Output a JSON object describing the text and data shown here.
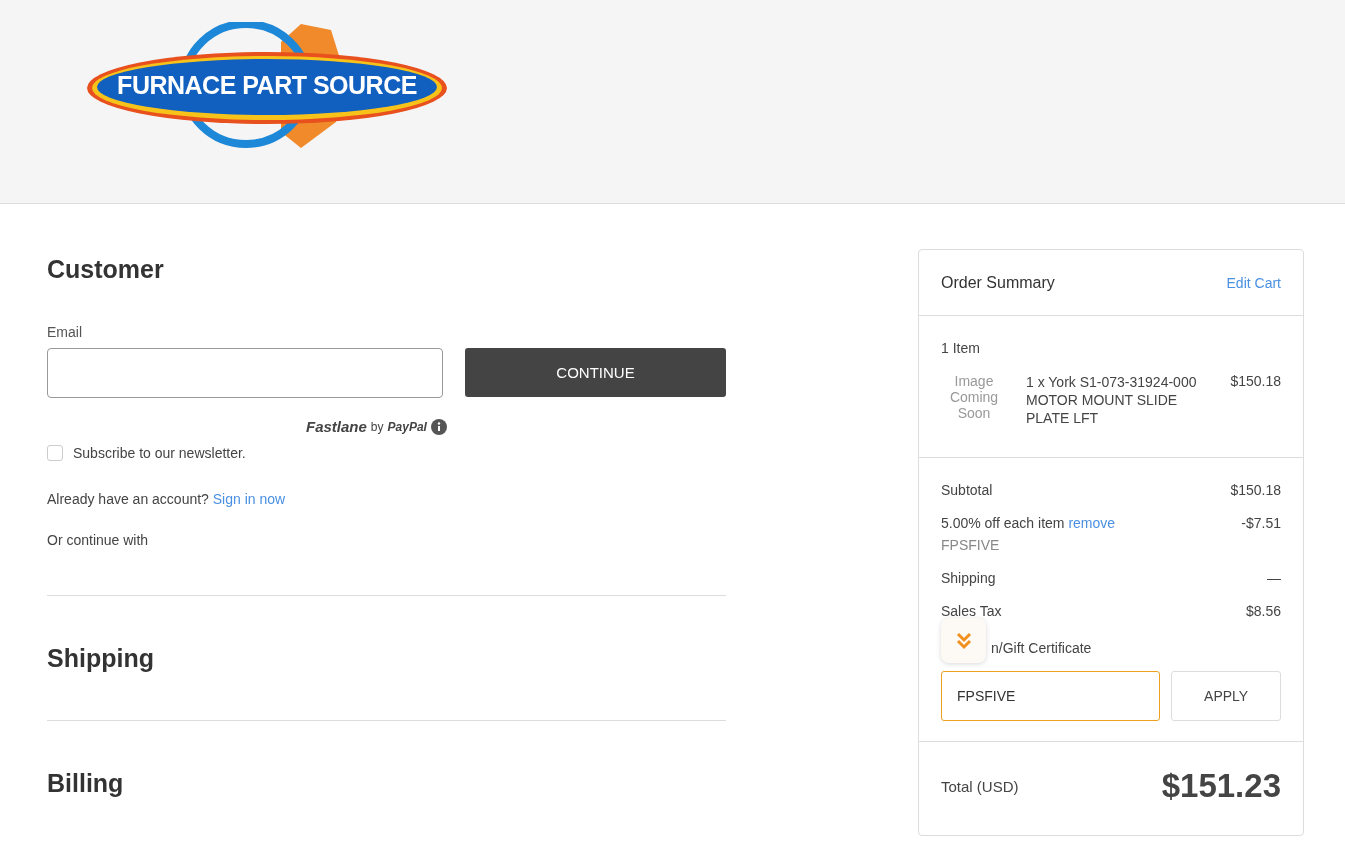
{
  "header": {
    "logo_text": "FURNACE PART SOURCE"
  },
  "customer": {
    "title": "Customer",
    "email_label": "Email",
    "continue_button": "CONTINUE",
    "fastlane": "Fastlane",
    "fastlane_by": "by",
    "fastlane_paypal": "PayPal",
    "newsletter": {
      "label": "Subscribe to our newsletter.",
      "checked": false
    },
    "account_prompt": "Already have an account?",
    "sign_in_link": "Sign in now",
    "or_continue": "Or continue with"
  },
  "sections": [
    "Shipping",
    "Billing"
  ],
  "order_summary": {
    "title": "Order Summary",
    "edit_cart": "Edit Cart",
    "item_count": "1 Item",
    "item": {
      "image_placeholder": "Image Coming Soon",
      "name": "1 x York S1-073-31924-000 MOTOR MOUNT SLIDE PLATE LFT",
      "price": "$150.18"
    },
    "lines": [
      {
        "label": "Subtotal",
        "value": "$150.18"
      },
      {
        "label": "5.00% off each item",
        "link": "remove",
        "code": "FPSFIVE",
        "value": "-$7.51"
      },
      {
        "label": "Shipping",
        "value": "—"
      },
      {
        "label": "Sales Tax",
        "value": "$8.56"
      }
    ],
    "coupon_label": "n/Gift Certificate",
    "coupon_value": "FPSFIVE",
    "apply_button": "APPLY",
    "total_label": "Total (USD)",
    "total_value": "$151.23"
  }
}
